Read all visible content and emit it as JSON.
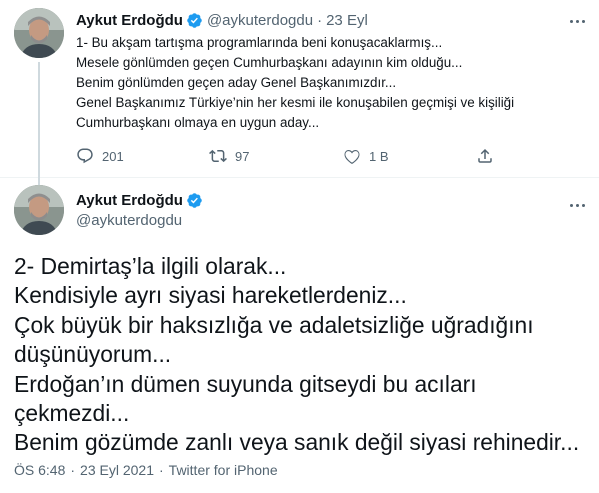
{
  "tweet1": {
    "author_name": "Aykut Erdoğdu",
    "handle": "@aykuterdogdu",
    "separator": "·",
    "date": "23 Eyl",
    "lines": [
      "1- Bu akşam tartışma programlarında beni konuşacaklarmış...",
      "Mesele gönlümden geçen Cumhurbaşkanı adayının kim olduğu...",
      "Benim gönlümden geçen aday Genel Başkanımızdır...",
      "Genel Başkanımız Türkiye’nin her kesmi ile konuşabilen geçmişi ve kişiliği",
      "Cumhurbaşkanı olmaya en uygun aday..."
    ],
    "reply_count": "201",
    "retweet_count": "97",
    "like_count": "1 B"
  },
  "tweet2": {
    "author_name": "Aykut Erdoğdu",
    "handle": "@aykuterdogdu",
    "lines": [
      "2- Demirtaş’la ilgili olarak...",
      "Kendisiyle ayrı siyasi hareketlerdeniz...",
      "Çok büyük bir haksızlığa ve adaletsizliğe uğradığını",
      "düşünüyorum...",
      "Erdoğan’ın dümen suyunda gitseydi bu acıları",
      "çekmezdi...",
      "Benim gözümde zanlı veya sanık değil siyasi rehinedir..."
    ],
    "time": "ÖS 6:48",
    "separator": "·",
    "date": "23 Eyl 2021",
    "source": "Twitter for iPhone"
  },
  "icons": {
    "verified": "verified-badge-icon",
    "more": "more-options-icon",
    "reply": "reply-icon",
    "retweet": "retweet-icon",
    "like": "heart-icon",
    "share": "share-icon"
  },
  "colors": {
    "verified_blue": "#1d9bf0",
    "muted_text": "#536471",
    "main_text": "#0f1419",
    "divider": "#eff3f4"
  }
}
